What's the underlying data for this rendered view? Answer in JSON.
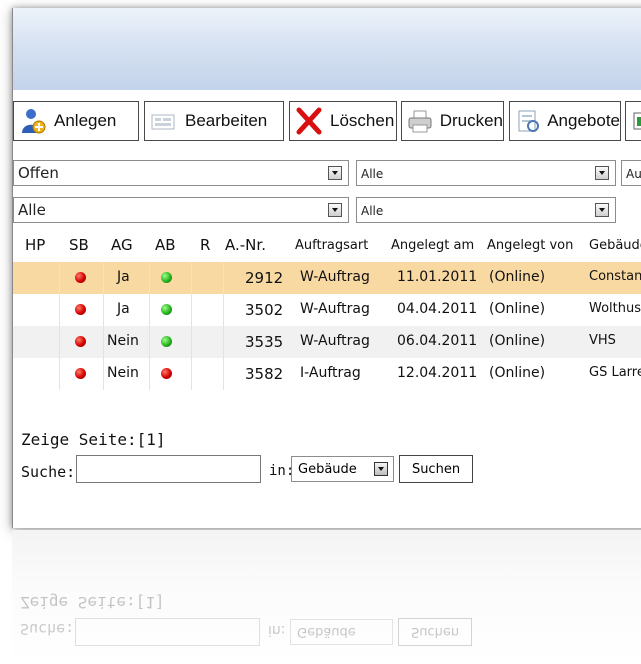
{
  "toolbar": {
    "buttons": [
      {
        "label": "Anlegen",
        "icon": "user-add-icon"
      },
      {
        "label": "Bearbeiten",
        "icon": "edit-icon"
      },
      {
        "label": "Löschen",
        "icon": "delete-x-icon"
      },
      {
        "label": "Drucken",
        "icon": "printer-icon"
      },
      {
        "label": "Angebote",
        "icon": "offer-icon"
      }
    ]
  },
  "filters": {
    "status": "Offen",
    "filter2": "Alle",
    "filter3": "Alle",
    "filter4": "Alle",
    "filter5_partial": "Au"
  },
  "table": {
    "headers": [
      "HP",
      "SB",
      "AG",
      "AB",
      "R",
      "A.-Nr.",
      "Auftragsart",
      "Angelegt am",
      "Angelegt von",
      "Gebäude"
    ],
    "rows": [
      {
        "sb": "red",
        "ag": "Ja",
        "ab": "green",
        "nr": "2912",
        "art": "W-Auftrag",
        "datum": "11.01.2011",
        "von": "(Online)",
        "gebaeude": "Constant",
        "selected": true
      },
      {
        "sb": "red",
        "ag": "Ja",
        "ab": "green",
        "nr": "3502",
        "art": "W-Auftrag",
        "datum": "04.04.2011",
        "von": "(Online)",
        "gebaeude": "Wolthuse"
      },
      {
        "sb": "red",
        "ag": "Nein",
        "ab": "green",
        "nr": "3535",
        "art": "W-Auftrag",
        "datum": "06.04.2011",
        "von": "(Online)",
        "gebaeude": "VHS"
      },
      {
        "sb": "red",
        "ag": "Nein",
        "ab": "red",
        "nr": "3582",
        "art": "I-Auftrag",
        "datum": "12.04.2011",
        "von": "(Online)",
        "gebaeude": "GS Larre"
      }
    ]
  },
  "pager": {
    "label": "Zeige Seite:",
    "current": "[1]"
  },
  "search": {
    "label": "Suche:",
    "value": "",
    "in_label": "in:",
    "field": "Gebäude",
    "button": "Suchen"
  },
  "colors": {
    "selected_row": "#f9d9a2",
    "status_red": "#d40000",
    "status_green": "#28b41e"
  }
}
